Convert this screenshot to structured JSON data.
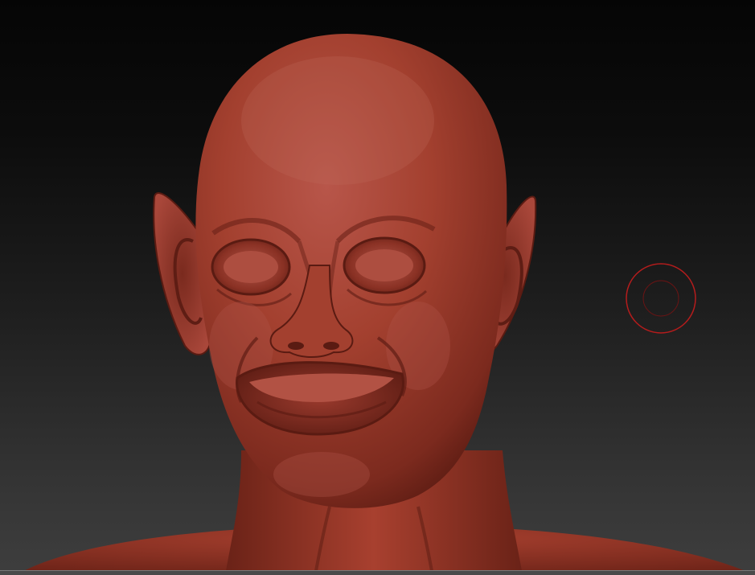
{
  "app": {
    "canvas_background_top": "#050505",
    "canvas_background_bottom": "#3e3e3e"
  },
  "model": {
    "subject": "sculpted-head-bust",
    "material_color": "#a8402f",
    "material_shadow": "#5a1b12",
    "material_highlight": "#c9705f"
  },
  "brush": {
    "icon": "brush-cursor-icon",
    "outer_ring_color": "#b41c1c",
    "inner_ring_color": "#6a1414"
  }
}
